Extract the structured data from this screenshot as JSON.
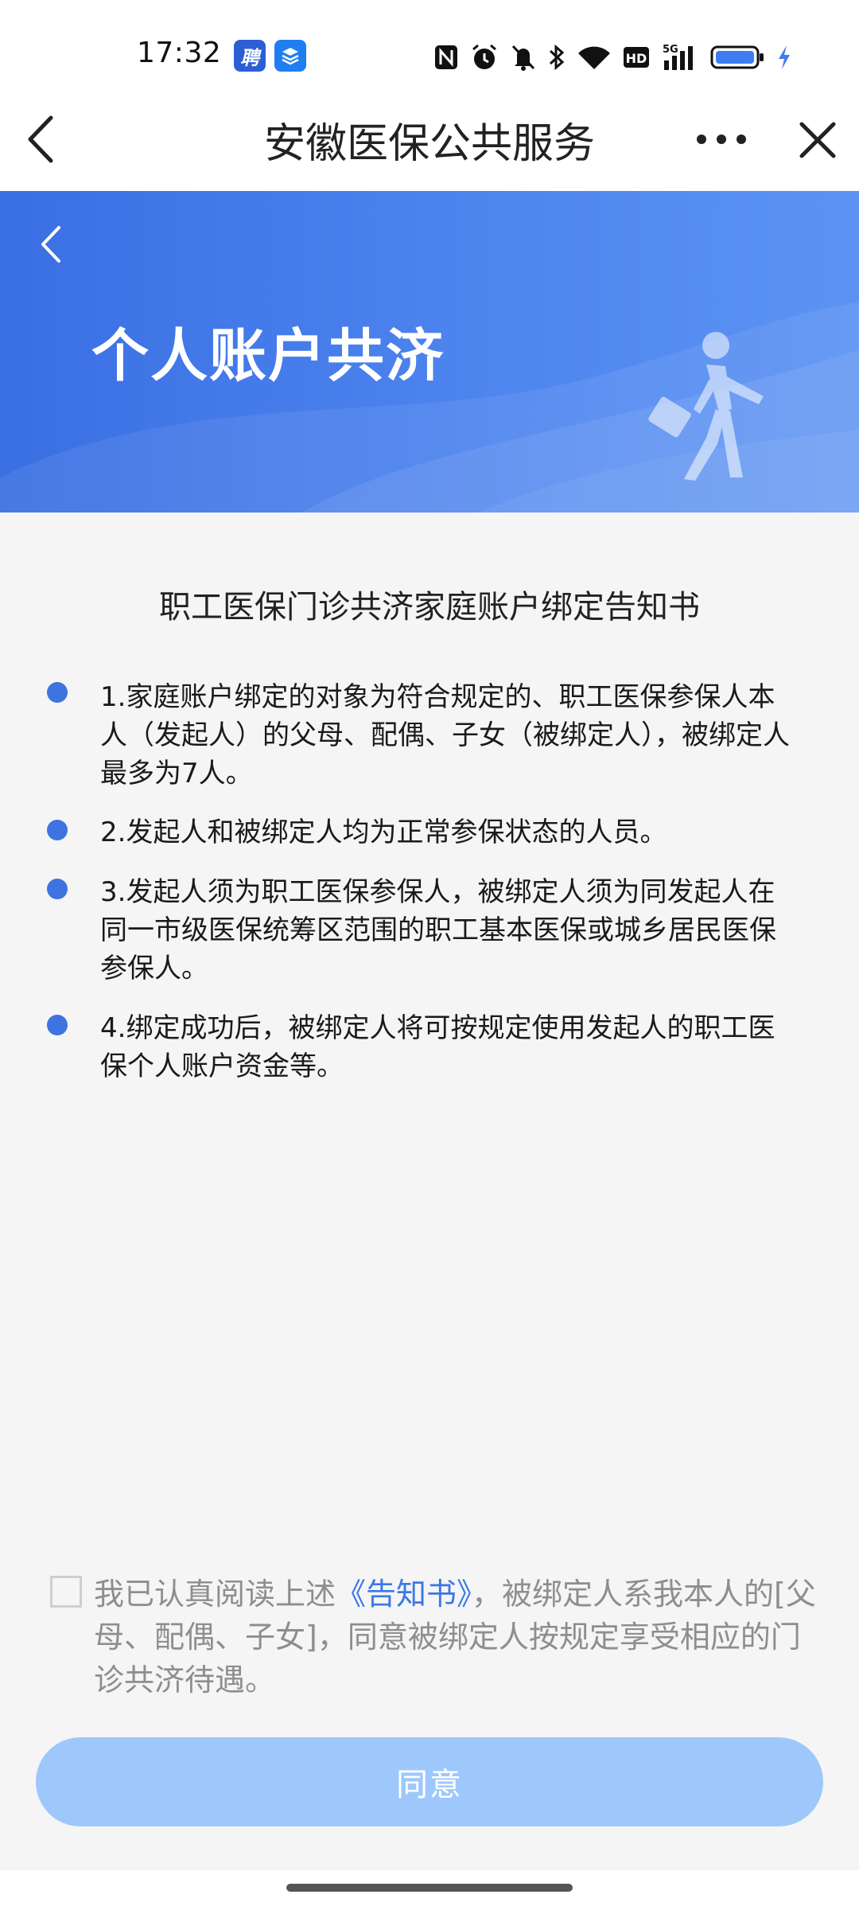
{
  "status_bar": {
    "time": "17:32",
    "app_badges": [
      "聘",
      "stack-icon"
    ],
    "network": "5G",
    "hd": "HD"
  },
  "nav": {
    "title": "安徽医保公共服务"
  },
  "banner": {
    "title": "个人账户共济"
  },
  "notice": {
    "title": "职工医保门诊共济家庭账户绑定告知书",
    "items": [
      "1.家庭账户绑定的对象为符合规定的、职工医保参保人本人（发起人）的父母、配偶、子女（被绑定人），被绑定人最多为7人。",
      "2.发起人和被绑定人均为正常参保状态的人员。",
      "3.发起人须为职工医保参保人，被绑定人须为同发起人在同一市级医保统筹区范围的职工基本医保或城乡居民医保参保人。",
      "4.绑定成功后，被绑定人将可按规定使用发起人的职工医保个人账户资金等。"
    ]
  },
  "agreement": {
    "checked": false,
    "text_before": "我已认真阅读上述",
    "link": "《告知书》",
    "text_after": "，被绑定人系我本人的[父母、配偶、子女]，同意被绑定人按规定享受相应的门诊共济待遇。",
    "button_label": "同意"
  },
  "colors": {
    "accent": "#3d74e0",
    "banner_start": "#3a6fe3",
    "button_disabled": "#9ec8fb",
    "link": "#3b78e7"
  }
}
